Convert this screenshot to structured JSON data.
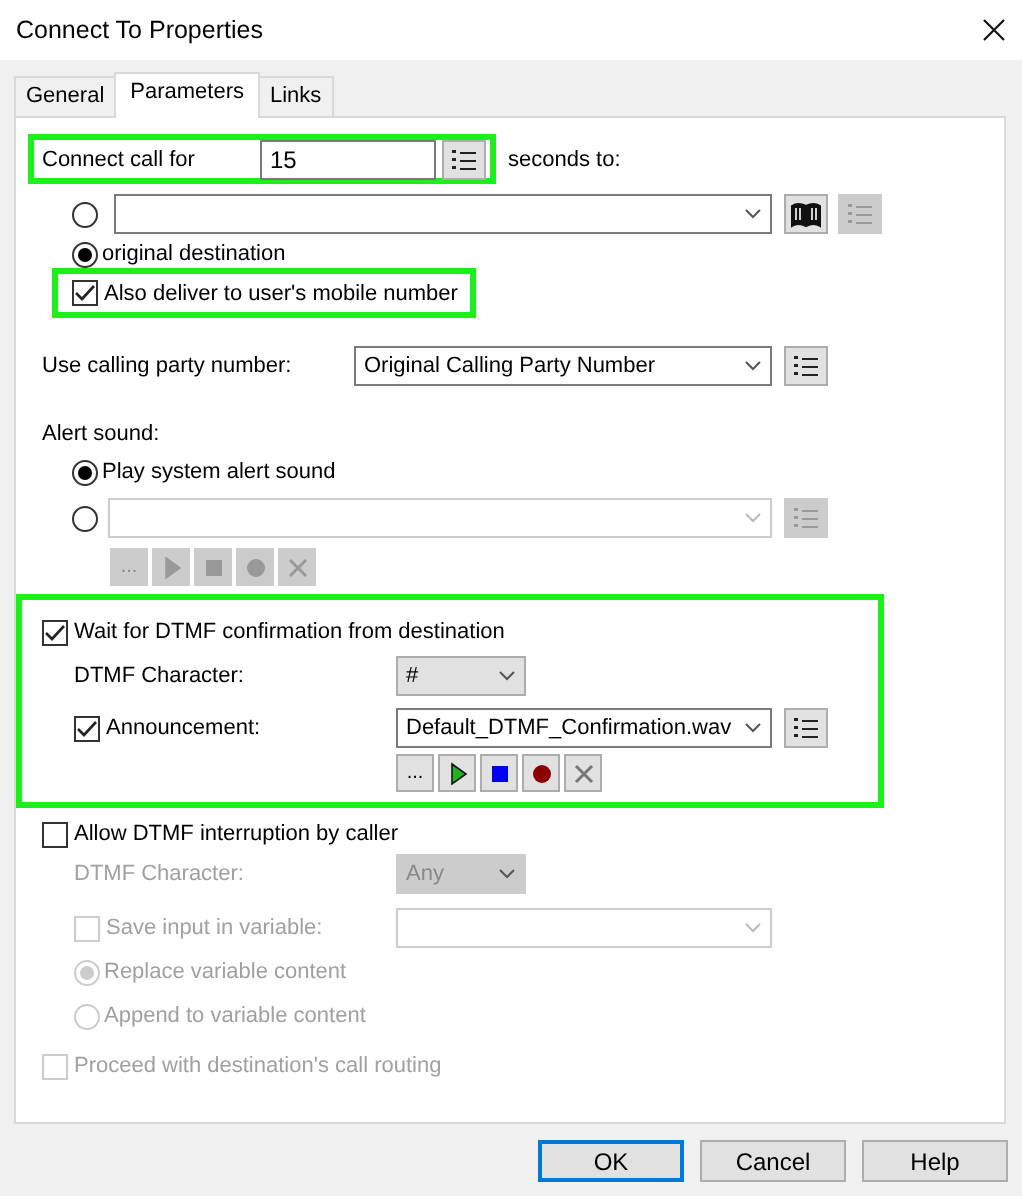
{
  "window": {
    "title": "Connect To Properties"
  },
  "tabs": [
    {
      "label": "General",
      "selected": false
    },
    {
      "label": "Parameters",
      "selected": true
    },
    {
      "label": "Links",
      "selected": false
    }
  ],
  "connect_call": {
    "highlighted": true,
    "label": "Connect call for",
    "value": "15",
    "suffix": "seconds to:"
  },
  "destination": {
    "options": [
      {
        "kind": "combo",
        "selected": false,
        "variable_disabled": true
      },
      {
        "kind": "text",
        "label": "original destination",
        "selected": true
      }
    ]
  },
  "mobile": {
    "highlighted": true,
    "label": "Also deliver to user's mobile number",
    "checked": true
  },
  "calling_party": {
    "label": "Use calling party number:",
    "value": "Original Calling Party Number"
  },
  "alert": {
    "label": "Alert sound:",
    "options": [
      {
        "kind": "text",
        "label": "Play system alert sound",
        "selected": true
      },
      {
        "kind": "combo",
        "selected": false,
        "variable_disabled": true
      }
    ],
    "player": {
      "disabled": true,
      "browse": "..."
    }
  },
  "dtmf_confirm": {
    "highlighted": true,
    "label": "Wait for DTMF confirmation from destination",
    "checked": true,
    "character_label": "DTMF Character:",
    "character": "#",
    "announcement": {
      "label": "Announcement:",
      "checked": true,
      "value": "Default_DTMF_Confirmation.wav",
      "player": {
        "disabled": false,
        "browse": "..."
      }
    }
  },
  "dtmf_interrupt": {
    "label": "Allow DTMF interruption by caller",
    "checked": false,
    "disabled": true,
    "character_label": "DTMF Character:",
    "character": "Any",
    "save": {
      "label": "Save input in variable:",
      "checked": false
    },
    "modes": [
      {
        "label": "Replace variable content",
        "selected": true
      },
      {
        "label": "Append to variable content",
        "selected": false
      }
    ]
  },
  "proceed": {
    "label": "Proceed with destination's call routing",
    "checked": false,
    "disabled": true
  },
  "buttons": [
    {
      "label": "OK",
      "default": true
    },
    {
      "label": "Cancel",
      "default": false
    },
    {
      "label": "Help",
      "default": false
    }
  ]
}
